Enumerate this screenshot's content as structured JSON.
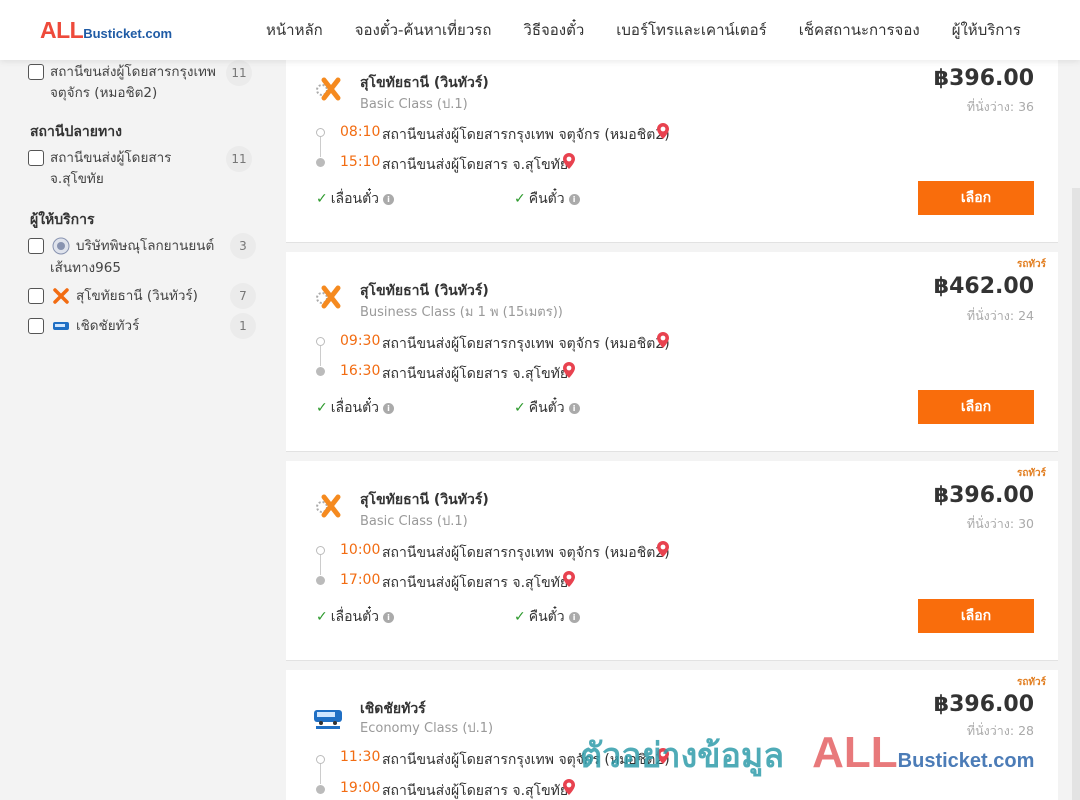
{
  "header": {
    "logo_main": "ALL",
    "logo_rest": "Busticket.com",
    "nav": [
      "หน้าหลัก",
      "จองตั๋ว-ค้นหาเที่ยวรถ",
      "วิธีจองตั๋ว",
      "เบอร์โทรและเคาน์เตอร์",
      "เช็คสถานะการจอง",
      "ผู้ให้บริการ"
    ]
  },
  "sidebar": {
    "origin_item": {
      "line1": "สถานีขนส่งผู้โดยสารกรุงเทพ",
      "line2": "จตุจักร (หมอชิต2)",
      "count": "11"
    },
    "dest_heading": "สถานีปลายทาง",
    "dest_item": {
      "line1": "สถานีขนส่งผู้โดยสาร",
      "line2": "จ.สุโขทัย",
      "count": "11"
    },
    "operator_heading": "ผู้ให้บริการ",
    "operators": [
      {
        "line1": "บริษัทพิษณุโลกยานยนต์",
        "line2": "เส้นทาง965",
        "count": "3",
        "icon": "pitsanulok-icon"
      },
      {
        "line1": "สุโขทัยธานี (วินทัวร์)",
        "line2": "",
        "count": "7",
        "icon": "sukhothai-win-tour-icon"
      },
      {
        "line1": "เชิดชัยทัวร์",
        "line2": "",
        "count": "1",
        "icon": "cherdchai-tour-icon"
      }
    ]
  },
  "trips": [
    {
      "operator": "สุโขทัยธานี (วินทัวร์)",
      "class": "Basic Class (ป.1)",
      "price": "฿396.00",
      "seats": "ที่นั่งว่าง: 36",
      "depart_time": "08:10",
      "depart_station": "สถานีขนส่งผู้โดยสารกรุงเทพ จตุจักร (หมอชิต2)",
      "arrive_time": "15:10",
      "arrive_station": "สถานีขนส่งผู้โดยสาร จ.สุโขทัย",
      "feature1": "เลื่อนตั๋ว",
      "feature2": "คืนตั๋ว",
      "button": "เลือก",
      "tag": "",
      "logo": "win-tour-logo"
    },
    {
      "operator": "สุโขทัยธานี (วินทัวร์)",
      "class": "Business Class (ม 1 พ (15เมตร))",
      "price": "฿462.00",
      "seats": "ที่นั่งว่าง: 24",
      "depart_time": "09:30",
      "depart_station": "สถานีขนส่งผู้โดยสารกรุงเทพ จตุจักร (หมอชิต2)",
      "arrive_time": "16:30",
      "arrive_station": "สถานีขนส่งผู้โดยสาร จ.สุโขทัย",
      "feature1": "เลื่อนตั๋ว",
      "feature2": "คืนตั๋ว",
      "button": "เลือก",
      "tag": "รถทัวร์",
      "logo": "win-tour-logo"
    },
    {
      "operator": "สุโขทัยธานี (วินทัวร์)",
      "class": "Basic Class (ป.1)",
      "price": "฿396.00",
      "seats": "ที่นั่งว่าง: 30",
      "depart_time": "10:00",
      "depart_station": "สถานีขนส่งผู้โดยสารกรุงเทพ จตุจักร (หมอชิต2)",
      "arrive_time": "17:00",
      "arrive_station": "สถานีขนส่งผู้โดยสาร จ.สุโขทัย",
      "feature1": "เลื่อนตั๋ว",
      "feature2": "คืนตั๋ว",
      "button": "เลือก",
      "tag": "รถทัวร์",
      "logo": "win-tour-logo"
    },
    {
      "operator": "เชิดชัยทัวร์",
      "class": "Economy Class (ป.1)",
      "price": "฿396.00",
      "seats": "ที่นั่งว่าง: 28",
      "depart_time": "11:30",
      "depart_station": "สถานีขนส่งผู้โดยสารกรุงเทพ จตุจักร (หมอชิต2)",
      "arrive_time": "19:00",
      "arrive_station": "สถานีขนส่งผู้โดยสาร จ.สุโขทัย",
      "feature1": "",
      "feature2": "",
      "button": "",
      "tag": "รถทัวร์",
      "logo": "cherdchai-logo"
    }
  ],
  "watermark": {
    "thai": "ตัวอย่างข้อมูล",
    "all": "ALL",
    "rest": "Busticket.com"
  },
  "colors": {
    "accent": "#f96d0c",
    "time": "#f26c12",
    "pin": "#e8424f",
    "check": "#2d9a2d",
    "logo_red": "#ee4a3b",
    "logo_blue": "#1f5ba5"
  }
}
